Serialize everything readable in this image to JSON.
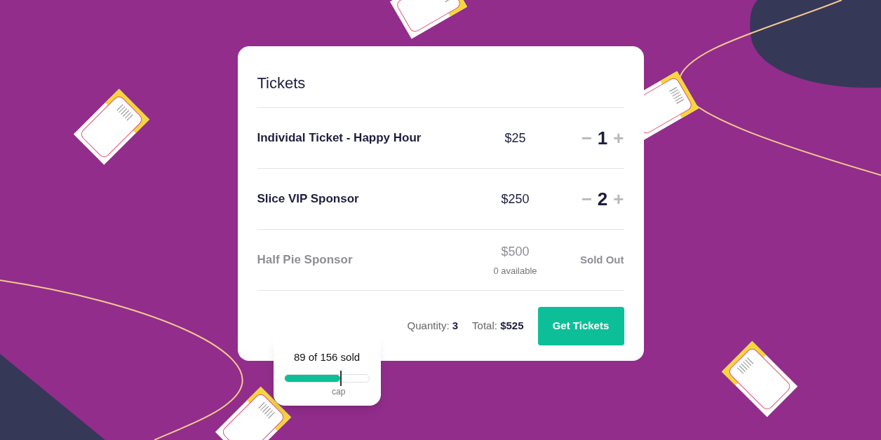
{
  "card": {
    "title": "Tickets",
    "rows": [
      {
        "kind": "stepper",
        "name": "Individal Ticket - Happy Hour",
        "price": "$25",
        "quantity": "1",
        "minus": "−",
        "plus": "+",
        "disabled": false
      },
      {
        "kind": "stepper",
        "name": "Slice VIP Sponsor",
        "price": "$250",
        "quantity": "2",
        "minus": "−",
        "plus": "+",
        "disabled": false
      },
      {
        "kind": "sold_out",
        "name": "Half Pie Sponsor",
        "price": "$500",
        "availability": "0 available",
        "status": "Sold Out",
        "disabled": true
      }
    ],
    "footer": {
      "quantity_label": "Quantity:",
      "quantity": "3",
      "total_label": "Total:",
      "total": "$525",
      "button": "Get Tickets"
    }
  },
  "sold_card": {
    "label": "89 of 156 sold",
    "level": 0.66,
    "marker": "cap"
  }
}
